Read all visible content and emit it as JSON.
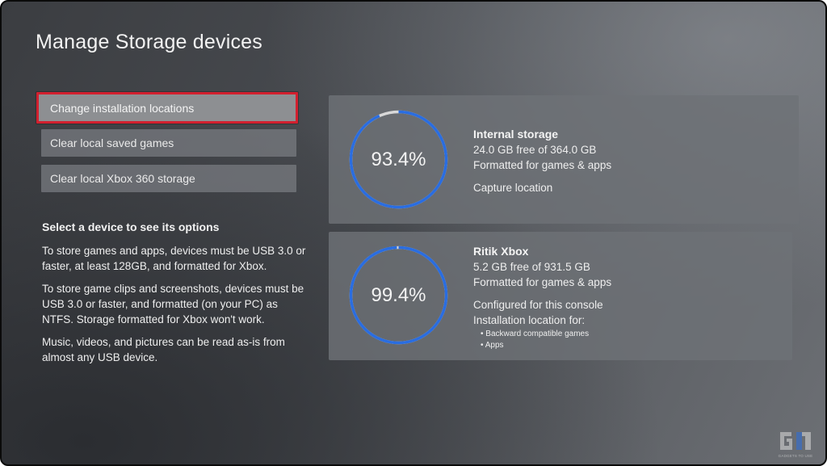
{
  "page_title": "Manage  Storage devices",
  "menu": [
    {
      "label": "Change installation locations",
      "focused": true
    },
    {
      "label": "Clear local saved games",
      "focused": false
    },
    {
      "label": "Clear local Xbox 360 storage",
      "focused": false
    }
  ],
  "info": {
    "heading": "Select a device to see its options",
    "paragraphs": [
      "To store games and apps, devices must be USB 3.0 or faster, at least 128GB, and formatted for Xbox.",
      "To store game clips and screenshots, devices must be USB 3.0 or faster, and formatted (on your PC) as NTFS. Storage formatted for Xbox won't work.",
      "Music, videos, and pictures can be read as-is from almost any USB device."
    ]
  },
  "devices": [
    {
      "percent_label": "93.4%",
      "used_fraction": 0.934,
      "name": "Internal storage",
      "free_text": "24.0 GB free of 364.0 GB",
      "format_text": "Formatted for games & apps",
      "note": "Capture location"
    },
    {
      "percent_label": "99.4%",
      "used_fraction": 0.994,
      "name": "Ritik Xbox",
      "free_text": "5.2 GB free of 931.5 GB",
      "format_text": "Formatted for games & apps",
      "note": "Configured for this console",
      "note2": "Installation location for:",
      "bullets": [
        "Backward compatible games",
        "Apps"
      ]
    }
  ],
  "colors": {
    "ring_used": "#2a6de0",
    "ring_free": "#d8d8d8",
    "focus_border": "#d2202f"
  },
  "watermark": {
    "icon": "gadgets-to-use-logo-icon",
    "text": "GADGETS TO USE"
  }
}
